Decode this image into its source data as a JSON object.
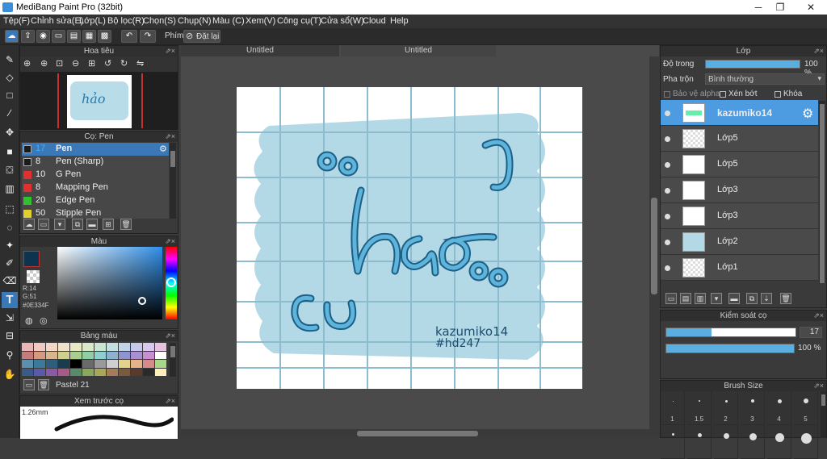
{
  "app": {
    "title": "MediBang Paint Pro (32bit)"
  },
  "menu": [
    "Tệp(F)",
    "Chỉnh sửa(E)",
    "Lớp(L)",
    "Bộ lọc(R)",
    "Chọn(S)",
    "Chụp(N)",
    "Màu (C)",
    "Xem(V)",
    "Công cụ(T)",
    "Cửa sổ(W)",
    "Cloud",
    "Help"
  ],
  "toolbar": {
    "shortcut_label": "Phím",
    "reset_label": "Đặt lại"
  },
  "navigator": {
    "title": "Hoa tiêu"
  },
  "brush_panel": {
    "title": "Cọ: Pen",
    "items": [
      {
        "size": "17",
        "name": "Pen",
        "color": "#1b1b1b",
        "selected": true
      },
      {
        "size": "8",
        "name": "Pen (Sharp)",
        "color": "#1b1b1b"
      },
      {
        "size": "10",
        "name": "G Pen",
        "color": "#e03030"
      },
      {
        "size": "8",
        "name": "Mapping Pen",
        "color": "#e03030"
      },
      {
        "size": "20",
        "name": "Edge Pen",
        "color": "#30c030"
      },
      {
        "size": "50",
        "name": "Stipple Pen",
        "color": "#e0d030"
      }
    ]
  },
  "color_panel": {
    "title": "Màu",
    "r": "R:14",
    "g": "G:51",
    "hex": "#0E334F",
    "current": "#0E334F"
  },
  "palette_panel": {
    "title": "Bảng màu",
    "name": "Pastel 21"
  },
  "preview_panel": {
    "title": "Xem trước cọ",
    "size": "1.26mm"
  },
  "tabs": [
    "Untitled",
    "Untitled"
  ],
  "artwork": {
    "text_main": "hảo",
    "signature1": "kazumiko14",
    "signature2": "#hd247"
  },
  "layer_panel": {
    "title": "Lớp",
    "opacity_label": "Độ trong",
    "opacity_value": "100 %",
    "opacity_fraction": 1.0,
    "blend_label": "Pha trộn",
    "blend_value": "Bình thường",
    "protect_alpha": "Bảo vệ alpha",
    "clip": "Xén bớt",
    "lock": "Khóa",
    "layers": [
      {
        "name": "kazumiko14",
        "selected": true
      },
      {
        "name": "Lớp5"
      },
      {
        "name": "Lớp5"
      },
      {
        "name": "Lớp3"
      },
      {
        "name": "Lớp3"
      },
      {
        "name": "Lớp2"
      },
      {
        "name": "Lớp1"
      }
    ]
  },
  "brush_control": {
    "title": "Kiểm soát cọ",
    "size_value": "17",
    "size_fraction": 0.35,
    "opacity_value": "100 %",
    "opacity_fraction": 1.0
  },
  "brush_size": {
    "title": "Brush Size",
    "sizes": [
      "1",
      "1.5",
      "2",
      "3",
      "4",
      "5"
    ]
  }
}
